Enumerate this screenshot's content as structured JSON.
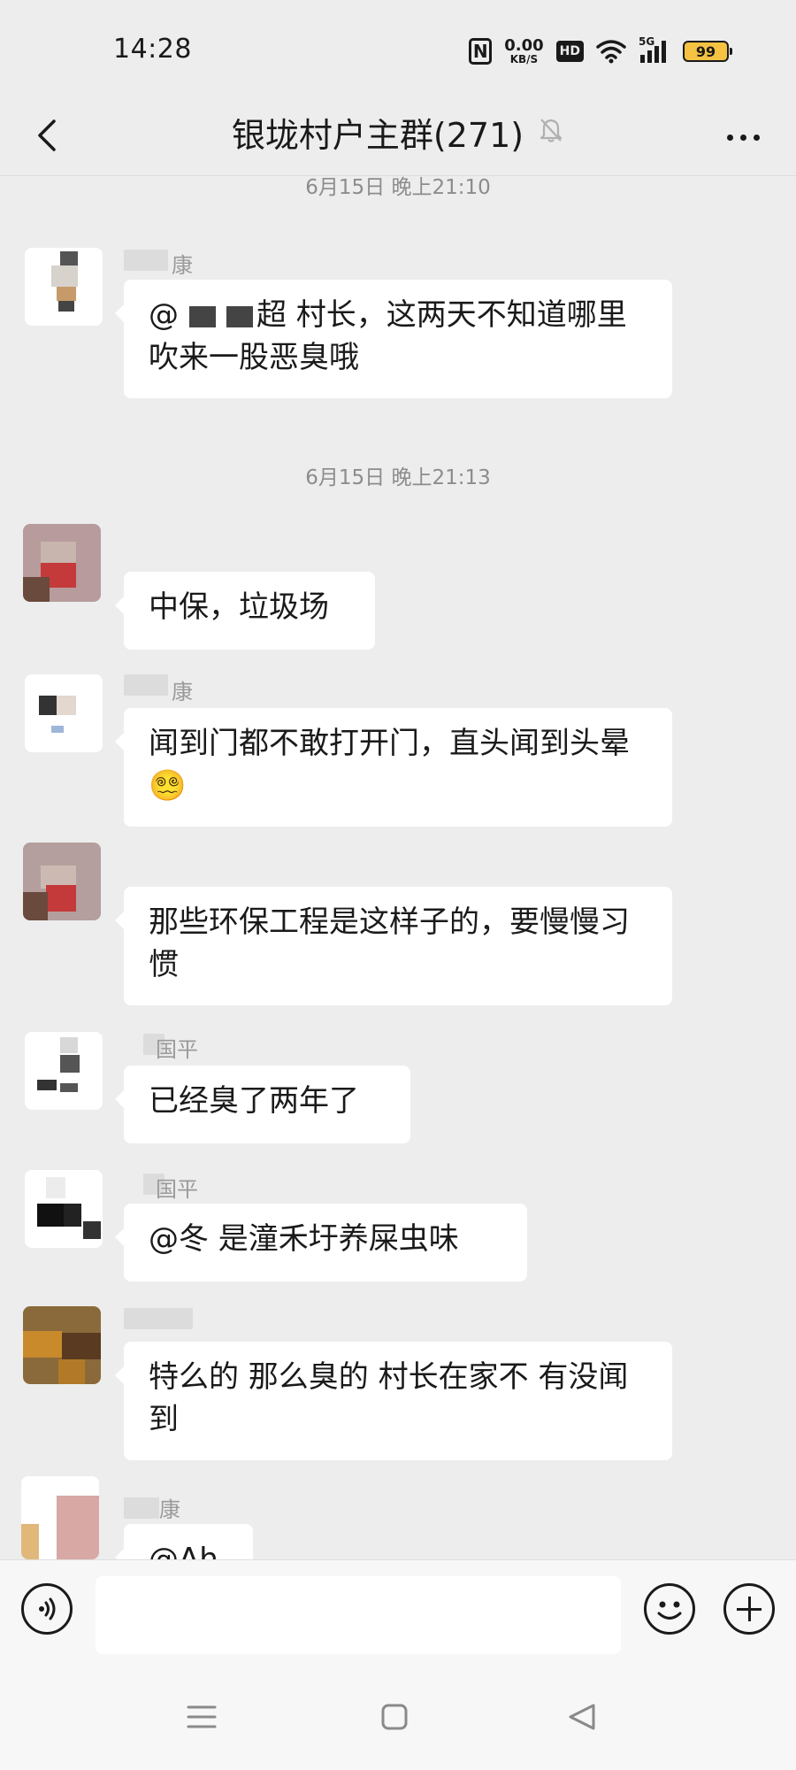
{
  "status_bar": {
    "time": "14:28",
    "net_speed_value": "0.00",
    "net_speed_unit": "KB/S",
    "hd_label": "HD",
    "network_label": "5G",
    "battery_level": "99"
  },
  "header": {
    "title": "银垅村户主群(271)"
  },
  "timestamps": [
    "6月15日 晚上21:10",
    "6月15日 晚上21:13"
  ],
  "messages": [
    {
      "sender": "康",
      "text": "超  村长，这两天不知道哪里吹来一股恶臭哦",
      "text_prefix": "@"
    },
    {
      "sender": "",
      "text": "中保，垃圾场"
    },
    {
      "sender": "康",
      "text": "闻到门都不敢打开门，直头闻到头晕",
      "emoji": "😵‍💫"
    },
    {
      "sender": "",
      "text": "那些环保工程是这样子的，要慢慢习惯"
    },
    {
      "sender": "国平",
      "text": "已经臭了两年了"
    },
    {
      "sender": "国平",
      "text": "@冬  是潼禾圩养屎虫味"
    },
    {
      "sender": "",
      "text": "特么的 那么臭的  村长在家不 有没闻到"
    },
    {
      "sender": "康",
      "text": "@Ah"
    }
  ],
  "input": {
    "value": ""
  },
  "icons": {
    "back": "back-arrow-icon",
    "mute": "bell-muted-icon",
    "more": "more-dots-icon",
    "voice": "voice-icon",
    "emoji": "emoji-icon",
    "plus": "plus-icon"
  },
  "colors": {
    "background": "#ededed",
    "bubble": "#ffffff",
    "timestamp": "#8c8c8c",
    "battery": "#f5c242"
  }
}
